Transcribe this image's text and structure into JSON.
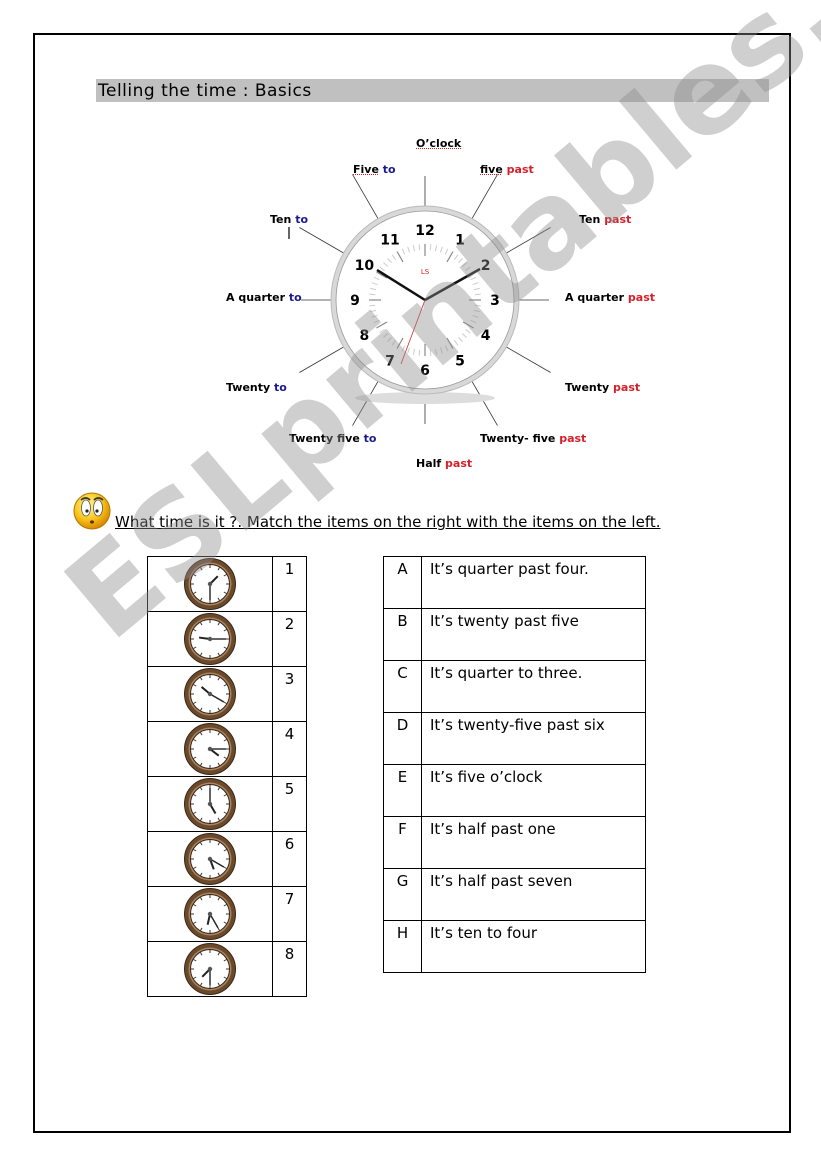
{
  "title": "Telling the time : Basics",
  "diagram": {
    "clock_numbers": [
      "12",
      "1",
      "2",
      "3",
      "4",
      "5",
      "6",
      "7",
      "8",
      "9",
      "10",
      "11"
    ],
    "brand_mark": "LS",
    "labels": {
      "oclock": {
        "main": "O’clock"
      },
      "five_past": {
        "main": "five",
        "suffix": "past"
      },
      "ten_past": {
        "main": "Ten",
        "suffix": "past"
      },
      "quarter_past": {
        "main": "A quarter",
        "suffix": "past"
      },
      "twenty_past": {
        "main": "Twenty",
        "suffix": "past"
      },
      "twentyfive_past": {
        "main": "Twenty- five",
        "suffix": "past"
      },
      "half_past": {
        "main": "Half",
        "suffix": "past"
      },
      "twentyfive_to": {
        "main": "Twenty five",
        "suffix": "to"
      },
      "twenty_to": {
        "main": "Twenty",
        "suffix": "to"
      },
      "quarter_to": {
        "main": "A quarter",
        "suffix": "to"
      },
      "ten_to": {
        "main": "Ten",
        "suffix": "to"
      },
      "five_to": {
        "main": "Five",
        "suffix": "to"
      }
    },
    "colors": {
      "to": "#1a1a8c",
      "past": "#d4202a"
    }
  },
  "instruction": "What time is it  ?.  Match the items on the right with the items on the left.",
  "clocks": [
    {
      "number": "1",
      "hour": 1,
      "minute": 30
    },
    {
      "number": "2",
      "hour": 9,
      "minute": 15
    },
    {
      "number": "3",
      "hour": 10,
      "minute": 20
    },
    {
      "number": "4",
      "hour": 4,
      "minute": 15
    },
    {
      "number": "5",
      "hour": 5,
      "minute": 0
    },
    {
      "number": "6",
      "hour": 5,
      "minute": 20
    },
    {
      "number": "7",
      "hour": 6,
      "minute": 25
    },
    {
      "number": "8",
      "hour": 7,
      "minute": 30
    }
  ],
  "answers": [
    {
      "letter": "A",
      "text": "It’s quarter past four."
    },
    {
      "letter": "B",
      "text": "It’s twenty past five"
    },
    {
      "letter": "C",
      "text": "It’s quarter to three."
    },
    {
      "letter": "D",
      "text": "It’s twenty-five past six"
    },
    {
      "letter": "E",
      "text": "It’s five o’clock"
    },
    {
      "letter": "F",
      "text": "It’s half past one"
    },
    {
      "letter": "G",
      "text": "It’s half past seven"
    },
    {
      "letter": "H",
      "text": "It’s ten to four"
    }
  ],
  "watermark": "ESLprintables.com"
}
